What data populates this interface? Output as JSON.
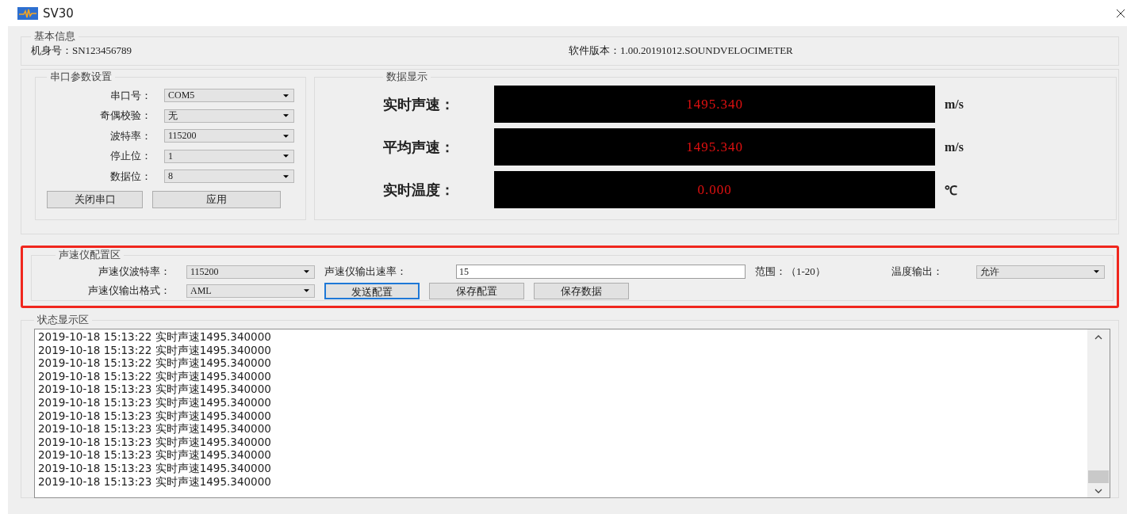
{
  "window": {
    "title": "SV30"
  },
  "basic_info": {
    "title": "基本信息",
    "fields": [
      {
        "label": "机身号：",
        "value": "SN123456789"
      },
      {
        "label": "软件版本：",
        "value": "1.00.20191012.SOUNDVELOCIMETER"
      }
    ]
  },
  "serial_settings": {
    "title": "串口参数设置",
    "fields": [
      {
        "label": "串口号：",
        "value": "COM5"
      },
      {
        "label": "奇偶校验：",
        "value": "无"
      },
      {
        "label": "波特率：",
        "value": "115200"
      },
      {
        "label": "停止位：",
        "value": "1"
      },
      {
        "label": "数据位：",
        "value": "8"
      }
    ],
    "buttons": [
      {
        "label": "关闭串口"
      },
      {
        "label": "应用"
      }
    ]
  },
  "data_display": {
    "title": "数据显示",
    "readings": [
      {
        "label": "实时声速：",
        "value": "1495.340",
        "unit": "m/s"
      },
      {
        "label": "平均声速：",
        "value": "1495.340",
        "unit": "m/s"
      },
      {
        "label": "实时温度：",
        "value": "0.000",
        "unit": "℃"
      }
    ]
  },
  "config": {
    "title": "声速仪配置区",
    "highlighted": true,
    "baud": {
      "label": "声速仪波特率：",
      "value": "115200"
    },
    "output_rate": {
      "label": "声速仪输出速率：",
      "value": "15"
    },
    "range": "范围：（1-20）",
    "temp_output": {
      "label": "温度输出：",
      "value": "允许"
    },
    "format": {
      "label": "声速仪输出格式：",
      "value": "AML"
    },
    "buttons": [
      {
        "label": "发送配置",
        "focused": true
      },
      {
        "label": "保存配置",
        "focused": false
      },
      {
        "label": "保存数据",
        "focused": false
      }
    ]
  },
  "status": {
    "title": "状态显示区",
    "lines": [
      "2019-10-18 15:13:22 实时声速1495.340000",
      "2019-10-18 15:13:22 实时声速1495.340000",
      "2019-10-18 15:13:22 实时声速1495.340000",
      "2019-10-18 15:13:22 实时声速1495.340000",
      "2019-10-18 15:13:23 实时声速1495.340000",
      "2019-10-18 15:13:23 实时声速1495.340000",
      "2019-10-18 15:13:23 实时声速1495.340000",
      "2019-10-18 15:13:23 实时声速1495.340000",
      "2019-10-18 15:13:23 实时声速1495.340000",
      "2019-10-18 15:13:23 实时声速1495.340000",
      "2019-10-18 15:13:23 实时声速1495.340000",
      "2019-10-18 15:13:23 实时声速1495.340000"
    ]
  }
}
